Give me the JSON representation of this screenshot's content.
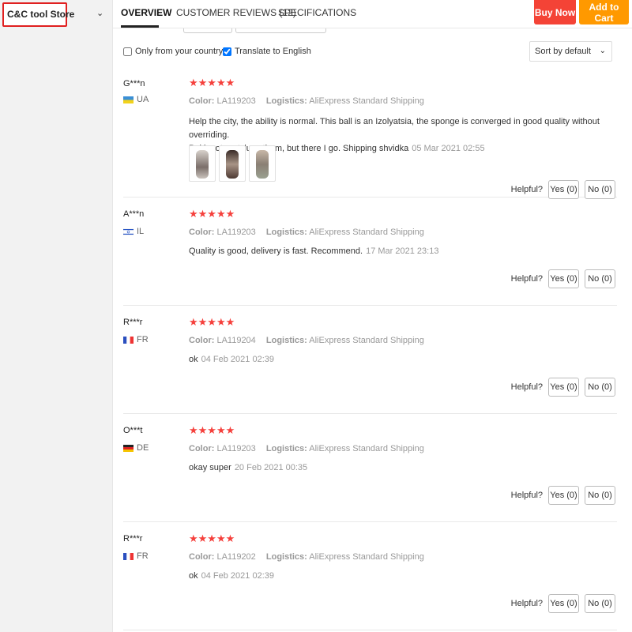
{
  "store": {
    "name": "C&C tool Store"
  },
  "header": {
    "tabs": [
      {
        "label": "OVERVIEW",
        "active": true
      },
      {
        "label": "CUSTOMER REVIEWS (12)",
        "active": false
      },
      {
        "label": "SPECIFICATIONS",
        "active": false
      }
    ],
    "buy_now": "Buy Now",
    "add_to_cart": "Add to Cart"
  },
  "filters": {
    "only_country": "Only from your country",
    "only_country_checked": false,
    "translate": "Translate to English",
    "translate_checked": true,
    "sort": "Sort by default"
  },
  "labels": {
    "color": "Color:",
    "logistics": "Logistics:",
    "helpful": "Helpful?"
  },
  "reviews": [
    {
      "user": "G***n",
      "country": "UA",
      "flag": "ua",
      "stars": "★★★★★",
      "color": "LA119203",
      "logistics": "AliExpress Standard Shipping",
      "text_line1": "Help the city, the ability is normal. This ball is an Izolyatsia, the sponge is converged in good quality without overriding.",
      "text_line2": "Poki, not pratsluva them, but there I go. Shipping shvidka",
      "date": "05 Mar 2021 02:55",
      "yes": "Yes (0)",
      "no": "No (0)"
    },
    {
      "user": "A***n",
      "country": "IL",
      "flag": "il",
      "stars": "★★★★★",
      "color": "LA119203",
      "logistics": "AliExpress Standard Shipping",
      "text_line1": "Quality is good, delivery is fast. Recommend.",
      "date": "17 Mar 2021 23:13",
      "yes": "Yes (0)",
      "no": "No (0)"
    },
    {
      "user": "R***r",
      "country": "FR",
      "flag": "fr",
      "stars": "★★★★★",
      "color": "LA119204",
      "logistics": "AliExpress Standard Shipping",
      "text_line1": "ok",
      "date": "04 Feb 2021 02:39",
      "yes": "Yes (0)",
      "no": "No (0)"
    },
    {
      "user": "O***t",
      "country": "DE",
      "flag": "de",
      "stars": "★★★★★",
      "color": "LA119203",
      "logistics": "AliExpress Standard Shipping",
      "text_line1": "okay super",
      "date": "20 Feb 2021 00:35",
      "yes": "Yes (0)",
      "no": "No (0)"
    },
    {
      "user": "R***r",
      "country": "FR",
      "flag": "fr",
      "stars": "★★★★★",
      "color": "LA119202",
      "logistics": "AliExpress Standard Shipping",
      "text_line1": "ok",
      "date": "04 Feb 2021 02:39",
      "yes": "Yes (0)",
      "no": "No (0)"
    }
  ],
  "colors": {
    "buy_now": "#f44336",
    "add_to_cart": "#ff9900",
    "stars": "#f5403c",
    "store_highlight": "#e02020"
  }
}
